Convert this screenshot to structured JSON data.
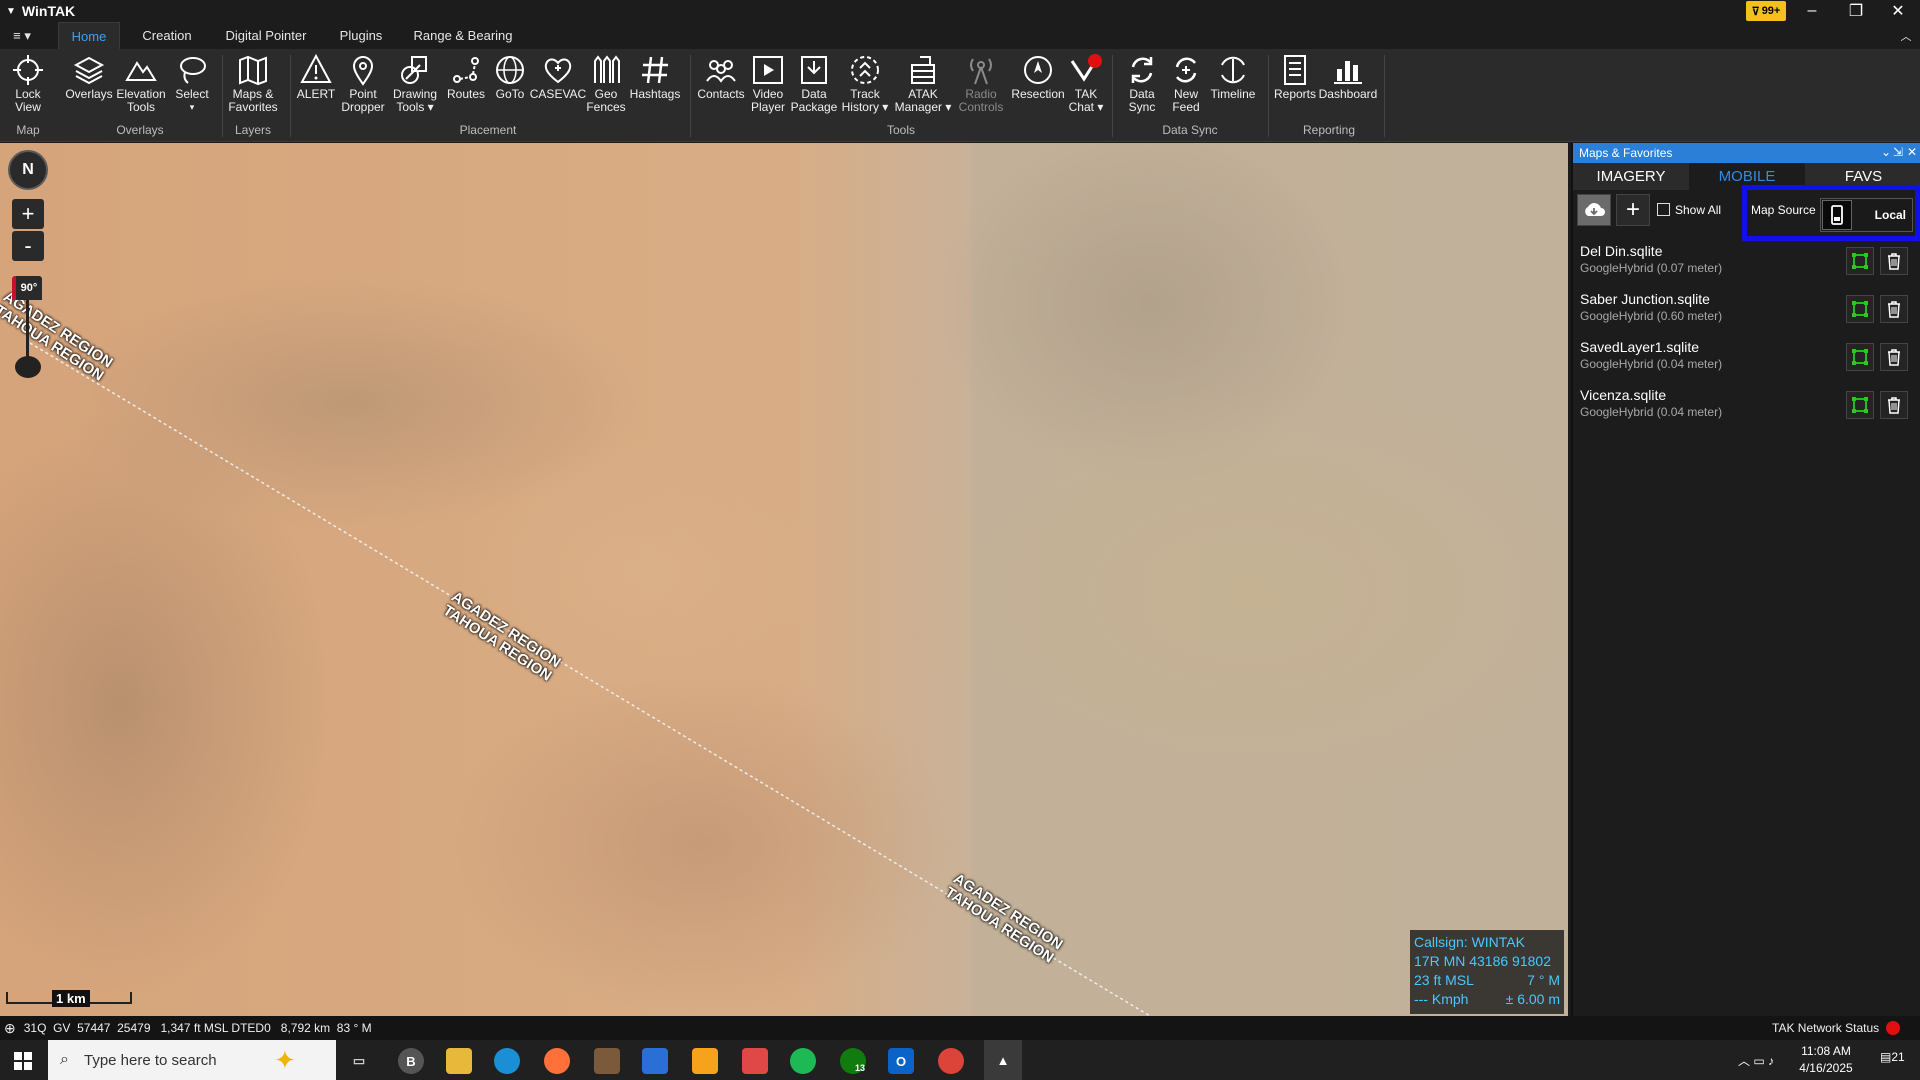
{
  "window": {
    "title": "WinTAK",
    "notification_count": "99+",
    "minimize": "–",
    "restore": "❐",
    "close": "✕"
  },
  "menu": {
    "hamburger": "≡ ▾"
  },
  "tabs": [
    {
      "label": "Home"
    },
    {
      "label": "Creation"
    },
    {
      "label": "Digital Pointer"
    },
    {
      "label": "Plugins"
    },
    {
      "label": "Range & Bearing"
    }
  ],
  "ribbon": {
    "buttons": [
      {
        "l1": "Lock",
        "l2": "View"
      },
      {
        "l1": "Overlays",
        "l2": ""
      },
      {
        "l1": "Elevation",
        "l2": "Tools"
      },
      {
        "l1": "Select",
        "l2": "▾"
      },
      {
        "l1": "Maps &",
        "l2": "Favorites"
      },
      {
        "l1": "ALERT",
        "l2": ""
      },
      {
        "l1": "Point",
        "l2": "Dropper"
      },
      {
        "l1": "Drawing",
        "l2": "Tools ▾"
      },
      {
        "l1": "Routes",
        "l2": ""
      },
      {
        "l1": "GoTo",
        "l2": ""
      },
      {
        "l1": "CASEVAC",
        "l2": ""
      },
      {
        "l1": "Geo",
        "l2": "Fences"
      },
      {
        "l1": "Hashtags",
        "l2": ""
      },
      {
        "l1": "Contacts",
        "l2": ""
      },
      {
        "l1": "Video",
        "l2": "Player"
      },
      {
        "l1": "Data",
        "l2": "Package"
      },
      {
        "l1": "Track",
        "l2": "History ▾"
      },
      {
        "l1": "ATAK",
        "l2": "Manager ▾"
      },
      {
        "l1": "Radio",
        "l2": "Controls"
      },
      {
        "l1": "Resection",
        "l2": ""
      },
      {
        "l1": "TAK",
        "l2": "Chat ▾"
      },
      {
        "l1": "Data",
        "l2": "Sync"
      },
      {
        "l1": "New",
        "l2": "Feed"
      },
      {
        "l1": "Timeline",
        "l2": ""
      },
      {
        "l1": "Reports",
        "l2": ""
      },
      {
        "l1": "Dashboard",
        "l2": ""
      }
    ],
    "groups": [
      "Map",
      "Overlays",
      "Layers",
      "Placement",
      "Tools",
      "Data Sync",
      "Reporting"
    ]
  },
  "map": {
    "compass": "N",
    "zoom_in": "+",
    "zoom_out": "-",
    "tilt": "90°",
    "region_labels": [
      {
        "l1": "AGADEZ REGION",
        "l2": "TAHOUA REGION"
      },
      {
        "l1": "AGADEZ REGION",
        "l2": "TAHOUA REGION"
      },
      {
        "l1": "AGADEZ REGION",
        "l2": "TAHOUA REGION"
      }
    ],
    "scale": "1 km",
    "self_info": {
      "callsign": "Callsign: WINTAK",
      "grid": "17R  MN  43186  91802",
      "alt": "23 ft MSL",
      "heading": "7 ° M",
      "speed": "--- Kmph",
      "accuracy": "± 6.00 m"
    }
  },
  "panel": {
    "title": "Maps & Favorites",
    "title_controls": [
      "⌄",
      "⇲",
      "✕"
    ],
    "tabs": [
      {
        "label": "IMAGERY"
      },
      {
        "label": "MOBILE"
      },
      {
        "label": "FAVS"
      }
    ],
    "active_tab": "MOBILE",
    "show_all": "Show All",
    "map_source_label": "Map Source",
    "map_source_value": "Local",
    "items": [
      {
        "name": "Del Din.sqlite",
        "detail": "GoogleHybrid (0.07 meter)"
      },
      {
        "name": "Saber Junction.sqlite",
        "detail": "GoogleHybrid (0.60 meter)"
      },
      {
        "name": "SavedLayer1.sqlite",
        "detail": "GoogleHybrid (0.04 meter)"
      },
      {
        "name": "Vicenza.sqlite",
        "detail": "GoogleHybrid (0.04 meter)"
      }
    ]
  },
  "statusbar": {
    "coords": "31Q  GV  57447  25479   1,347 ft MSL DTED0   8,792 km  83 ° M",
    "network": "TAK Network Status"
  },
  "taskbar": {
    "search_placeholder": "Type here to search",
    "time": "11:08 AM",
    "date": "4/16/2025",
    "notif_count": "21",
    "xbox_badge": "13"
  },
  "colors": {
    "accent": "#2f8ce8",
    "highlight_box": "#1010e8",
    "selfinfo_text": "#48c8ff",
    "geo_icon": "#22cc22"
  }
}
